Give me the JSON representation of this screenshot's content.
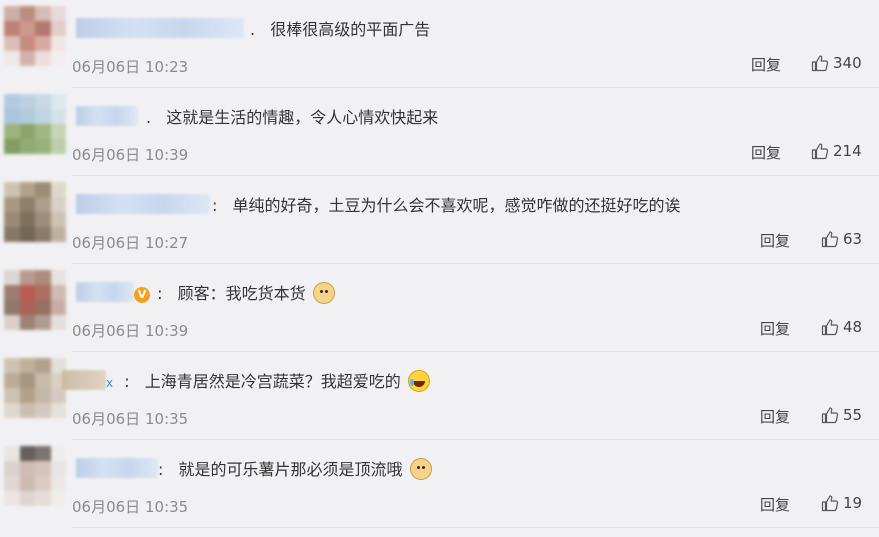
{
  "comments": [
    {
      "text": "很棒很高级的平面广告",
      "separator": ".",
      "time": "06月06日 10:23",
      "reply": "回复",
      "likes": "340"
    },
    {
      "text": "这就是生活的情趣，令人心情欢快起来",
      "separator": ".",
      "time": "06月06日 10:39",
      "reply": "回复",
      "likes": "214"
    },
    {
      "text": "单纯的好奇，土豆为什么会不喜欢呢，感觉咋做的还挺好吃的诶",
      "separator": ":",
      "time": "06月06日 10:27",
      "reply": "回复",
      "likes": "63"
    },
    {
      "text": "顾客：我吃货本货",
      "separator": ":",
      "time": "06月06日 10:39",
      "reply": "回复",
      "likes": "48",
      "badge": "V",
      "emoji": "dog-emoji"
    },
    {
      "text": "上海青居然是冷宫蔬菜？我超爱吃的",
      "separator": ":",
      "time": "06月06日 10:35",
      "reply": "回复",
      "likes": "55",
      "badge": "x",
      "emoji": "laughing-tears-emoji"
    },
    {
      "text": "就是的可乐薯片那必须是顶流哦",
      "separator": ":",
      "time": "06月06日 10:35",
      "reply": "回复",
      "likes": "19",
      "emoji": "dog-emoji"
    }
  ],
  "icons": {
    "like": "thumbs-up-icon"
  },
  "colors": {
    "background": "#f1f1f3",
    "time": "#8b8b8b",
    "divider": "#e2e2e5"
  }
}
